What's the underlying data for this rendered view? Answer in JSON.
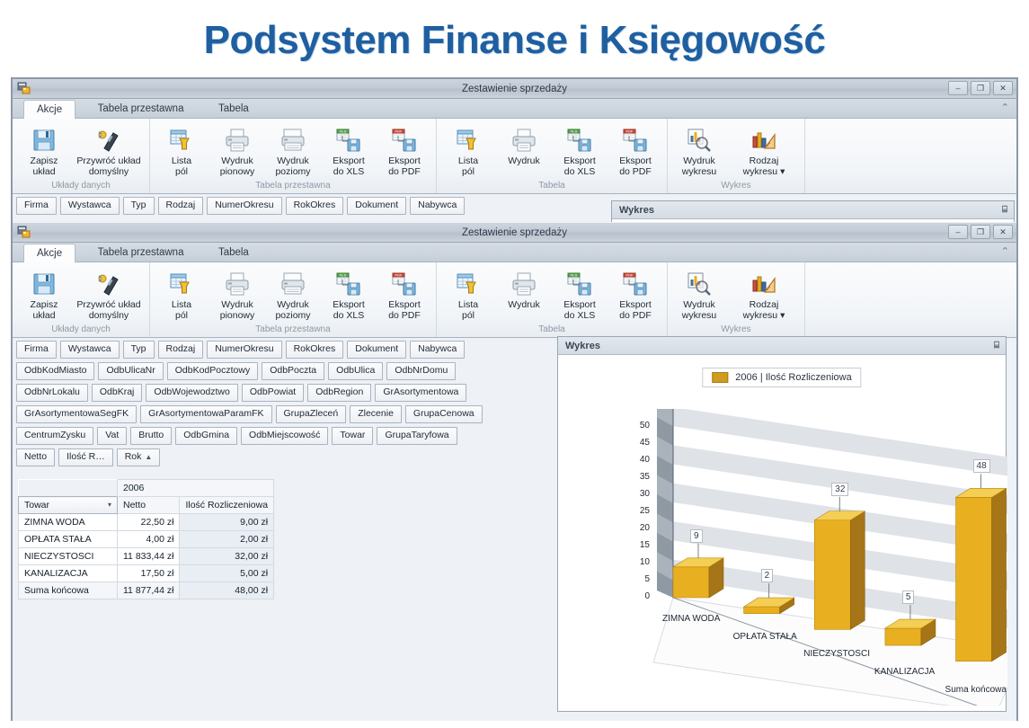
{
  "slide": {
    "title": "Podsystem Finanse i Księgowość"
  },
  "window": {
    "title": "Zestawienie sprzedaży",
    "icon": "app-icon",
    "buttons": {
      "minimize": "–",
      "restore": "❐",
      "close": "✕",
      "collapse_ribbon": "⌃"
    },
    "tabs": [
      {
        "label": "Akcje",
        "active": true
      },
      {
        "label": "Tabela przestawna",
        "active": false
      },
      {
        "label": "Tabela",
        "active": false
      }
    ]
  },
  "ribbon": {
    "groups": [
      {
        "label": "Układy danych",
        "buttons": [
          {
            "label": "Zapisz układ",
            "line1": "Zapisz",
            "line2": "układ",
            "icon": "save-floppy-icon"
          },
          {
            "label": "Przywróć układ domyślny",
            "line1": "Przywróć układ",
            "line2": "domyślny",
            "icon": "restore-layout-icon"
          }
        ]
      },
      {
        "label": "Tabela przestawna",
        "buttons": [
          {
            "line1": "Lista",
            "line2": "pól",
            "icon": "field-list-icon"
          },
          {
            "line1": "Wydruk",
            "line2": "pionowy",
            "icon": "printer-portrait-icon"
          },
          {
            "line1": "Wydruk",
            "line2": "poziomy",
            "icon": "printer-landscape-icon"
          },
          {
            "line1": "Eksport",
            "line2": "do XLS",
            "icon": "export-xls-icon"
          },
          {
            "line1": "Eksport",
            "line2": "do PDF",
            "icon": "export-pdf-icon"
          }
        ]
      },
      {
        "label": "Tabela",
        "buttons": [
          {
            "line1": "Lista",
            "line2": "pól",
            "icon": "field-list-icon"
          },
          {
            "line1": "Wydruk",
            "line2": "",
            "icon": "printer-portrait-icon"
          },
          {
            "line1": "Eksport",
            "line2": "do XLS",
            "icon": "export-xls-icon"
          },
          {
            "line1": "Eksport",
            "line2": "do PDF",
            "icon": "export-pdf-icon"
          }
        ]
      },
      {
        "label": "Wykres",
        "buttons": [
          {
            "line1": "Wydruk",
            "line2": "wykresu",
            "icon": "print-chart-icon"
          },
          {
            "line1": "Rodzaj",
            "line2": "wykresu ▾",
            "icon": "chart-type-icon"
          }
        ]
      }
    ]
  },
  "fields": {
    "row1": [
      "Firma",
      "Wystawca",
      "Typ",
      "Rodzaj",
      "NumerOkresu",
      "RokOkres",
      "Dokument",
      "Nabywca"
    ],
    "row2": [
      "OdbKodMiasto",
      "OdbUlicaNr",
      "OdbKodPocztowy",
      "OdbPoczta",
      "OdbUlica",
      "OdbNrDomu"
    ],
    "row3": [
      "OdbNrLokalu",
      "OdbKraj",
      "OdbWojewodztwo",
      "OdbPowiat",
      "OdbRegion",
      "GrAsortymentowa"
    ],
    "row4": [
      "GrAsortymentowaSegFK",
      "GrAsortymentowaParamFK",
      "GrupaZleceń",
      "Zlecenie",
      "GrupaCenowa"
    ],
    "row5": [
      "CentrumZysku",
      "Vat",
      "Brutto",
      "OdbGmina",
      "OdbMiejscowość",
      "Towar",
      "GrupaTaryfowa"
    ],
    "row6": [
      "Netto",
      "Ilość R…",
      "Rok"
    ],
    "row6_sort_arrow": "▲"
  },
  "pivot": {
    "row_field": "Towar",
    "row_field_caret": "▾",
    "year_header": "2006",
    "col_headers": [
      "Netto",
      "Ilość Rozliczeniowa"
    ],
    "rows": [
      {
        "label": "ZIMNA WODA",
        "netto": "22,50 zł",
        "ilosc": "9,00 zł"
      },
      {
        "label": "OPŁATA STAŁA",
        "netto": "4,00 zł",
        "ilosc": "2,00 zł"
      },
      {
        "label": "NIECZYSTOSCI",
        "netto": "11 833,44 zł",
        "ilosc": "32,00 zł"
      },
      {
        "label": "KANALIZACJA",
        "netto": "17,50 zł",
        "ilosc": "5,00 zł"
      }
    ],
    "total": {
      "label": "Suma końcowa",
      "netto": "11 877,44 zł",
      "ilosc": "48,00 zł"
    }
  },
  "chart_panel": {
    "header": "Wykres",
    "pin_icon": "pin-icon"
  },
  "chart_data": {
    "type": "bar",
    "title": "",
    "subtitle": "",
    "xlabel": "",
    "ylabel": "",
    "legend": [
      {
        "name": "2006   |  Ilość Rozliczeniowa",
        "color": "#cf9b21"
      }
    ],
    "legend_position": "top-center",
    "grid": true,
    "ylim": [
      0,
      50
    ],
    "yticks": [
      0,
      5,
      10,
      15,
      20,
      25,
      30,
      35,
      40,
      45,
      50
    ],
    "categories": [
      "ZIMNA WODA",
      "OPŁATA STAŁA",
      "NIECZYSTOSCI",
      "KANALIZACJA",
      "Suma końcowa"
    ],
    "values": [
      9,
      2,
      32,
      5,
      48
    ],
    "data_labels": [
      "9",
      "2",
      "32",
      "5",
      "48"
    ],
    "bar_color": "#e8b020",
    "bar_side_color": "#a67518"
  }
}
